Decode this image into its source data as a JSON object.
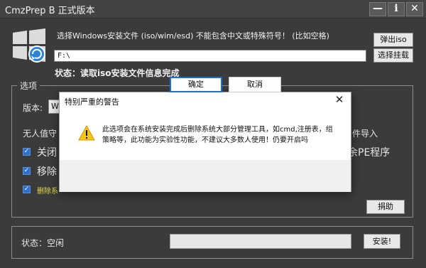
{
  "window": {
    "title": "CmzPrep B 正式版本",
    "minimize_label": "—",
    "info_label": "i",
    "close_label": "✕"
  },
  "source": {
    "hint": "选择Windows安装文件 (iso/wim/esd) 不能包含中文或特殊符号！ (比如空格)",
    "path_value": "F:\\",
    "eject_label": "弹出iso",
    "mount_label": "选择挂载",
    "status": "状态：读取iso安装文件信息完成"
  },
  "options": {
    "group_title": "选项",
    "version_label": "版本:",
    "version_value": "W",
    "unattended_label": "无人值守",
    "import_label": "件导入",
    "option1_label": "关闭",
    "option2_label": "移除",
    "option3_label": "删除系",
    "pe_label": "余PE程序",
    "donate_label": "捐助"
  },
  "bottom": {
    "status": "状态：空闲",
    "progress": 0,
    "install_label": "安装!"
  },
  "dialog": {
    "title": "特别严重的警告",
    "message": "此选项会在系统安装完成后删除系统大部分管理工具，如cmd,注册表，组策略等，此功能为实验性功能，不建议大多数人使用！仍要开启吗",
    "ok_label": "确定",
    "cancel_label": "取消",
    "close_label": "✕"
  },
  "colors": {
    "window_bg": "#3b3b3b",
    "accent_check": "#2f6fcc",
    "warning_yellow": "#f5c518",
    "option3_text": "#e8d84a"
  }
}
